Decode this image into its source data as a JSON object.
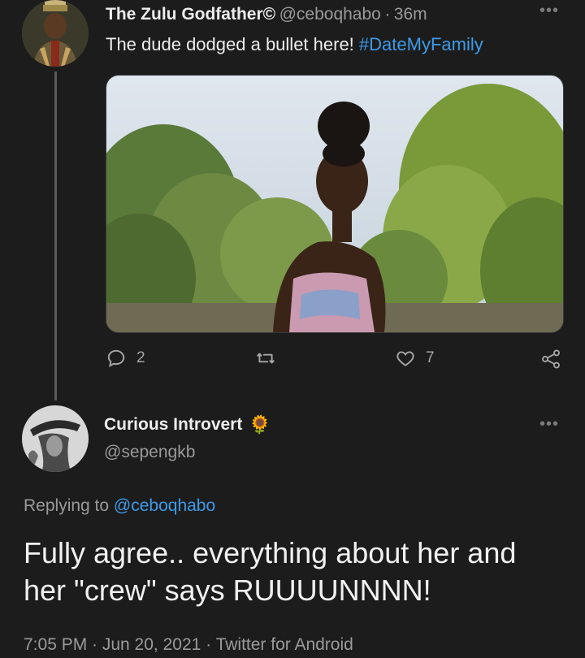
{
  "tweet": {
    "author_name": "The Zulu Godfather©",
    "author_handle": "@ceboqhabo",
    "separator": "·",
    "time": "36m",
    "text": "The dude dodged a bullet here! ",
    "hashtag": "#DateMyFamily",
    "reply_count": "2",
    "like_count": "7"
  },
  "reply": {
    "author_name": "Curious Introvert",
    "author_emoji": "🌻",
    "author_handle": "@sepengkb",
    "replying_label": "Replying to ",
    "replying_handle": "@ceboqhabo",
    "text_line1": "Fully agree.. everything about her and",
    "text_line2": "her \"crew\" says RUUUUNNNN!",
    "timestamp": "7:05 PM · Jun 20, 2021 · Twitter for Android"
  },
  "icons": {
    "reply": "reply-icon",
    "retweet": "retweet-icon",
    "like": "heart-icon",
    "share": "share-icon",
    "more": "more-icon"
  },
  "colors": {
    "background": "#1c1c1c",
    "accent": "#3d9ae8",
    "secondary_text": "#9a9a9a"
  }
}
